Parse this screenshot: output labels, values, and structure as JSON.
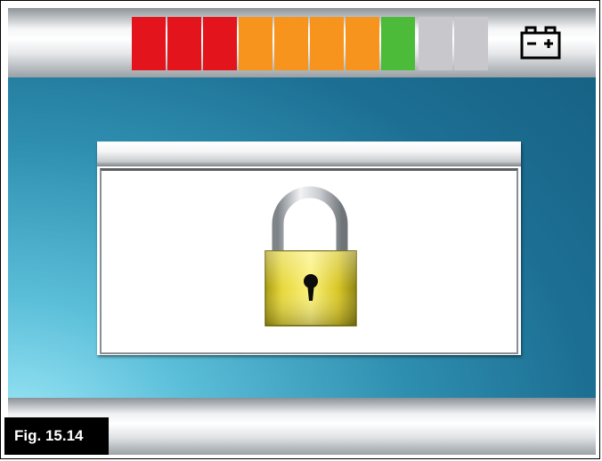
{
  "status_bar": {
    "battery_level_segments": [
      {
        "state": "on",
        "color": "#e3141b"
      },
      {
        "state": "on",
        "color": "#e3141b"
      },
      {
        "state": "on",
        "color": "#e3141b"
      },
      {
        "state": "on",
        "color": "#f7941d"
      },
      {
        "state": "on",
        "color": "#f7941d"
      },
      {
        "state": "on",
        "color": "#f7941d"
      },
      {
        "state": "on",
        "color": "#f7941d"
      },
      {
        "state": "on",
        "color": "#4cbb3a"
      },
      {
        "state": "off",
        "color": "#c8c8cc"
      },
      {
        "state": "off",
        "color": "#c8c8cc"
      }
    ],
    "battery_icon": "battery-icon"
  },
  "dialog": {
    "icon": "padlock-icon",
    "icon_colors": {
      "shackle": "#b8bcc0",
      "body": "#e2d01a"
    }
  },
  "figure_label": "Fig. 15.14"
}
